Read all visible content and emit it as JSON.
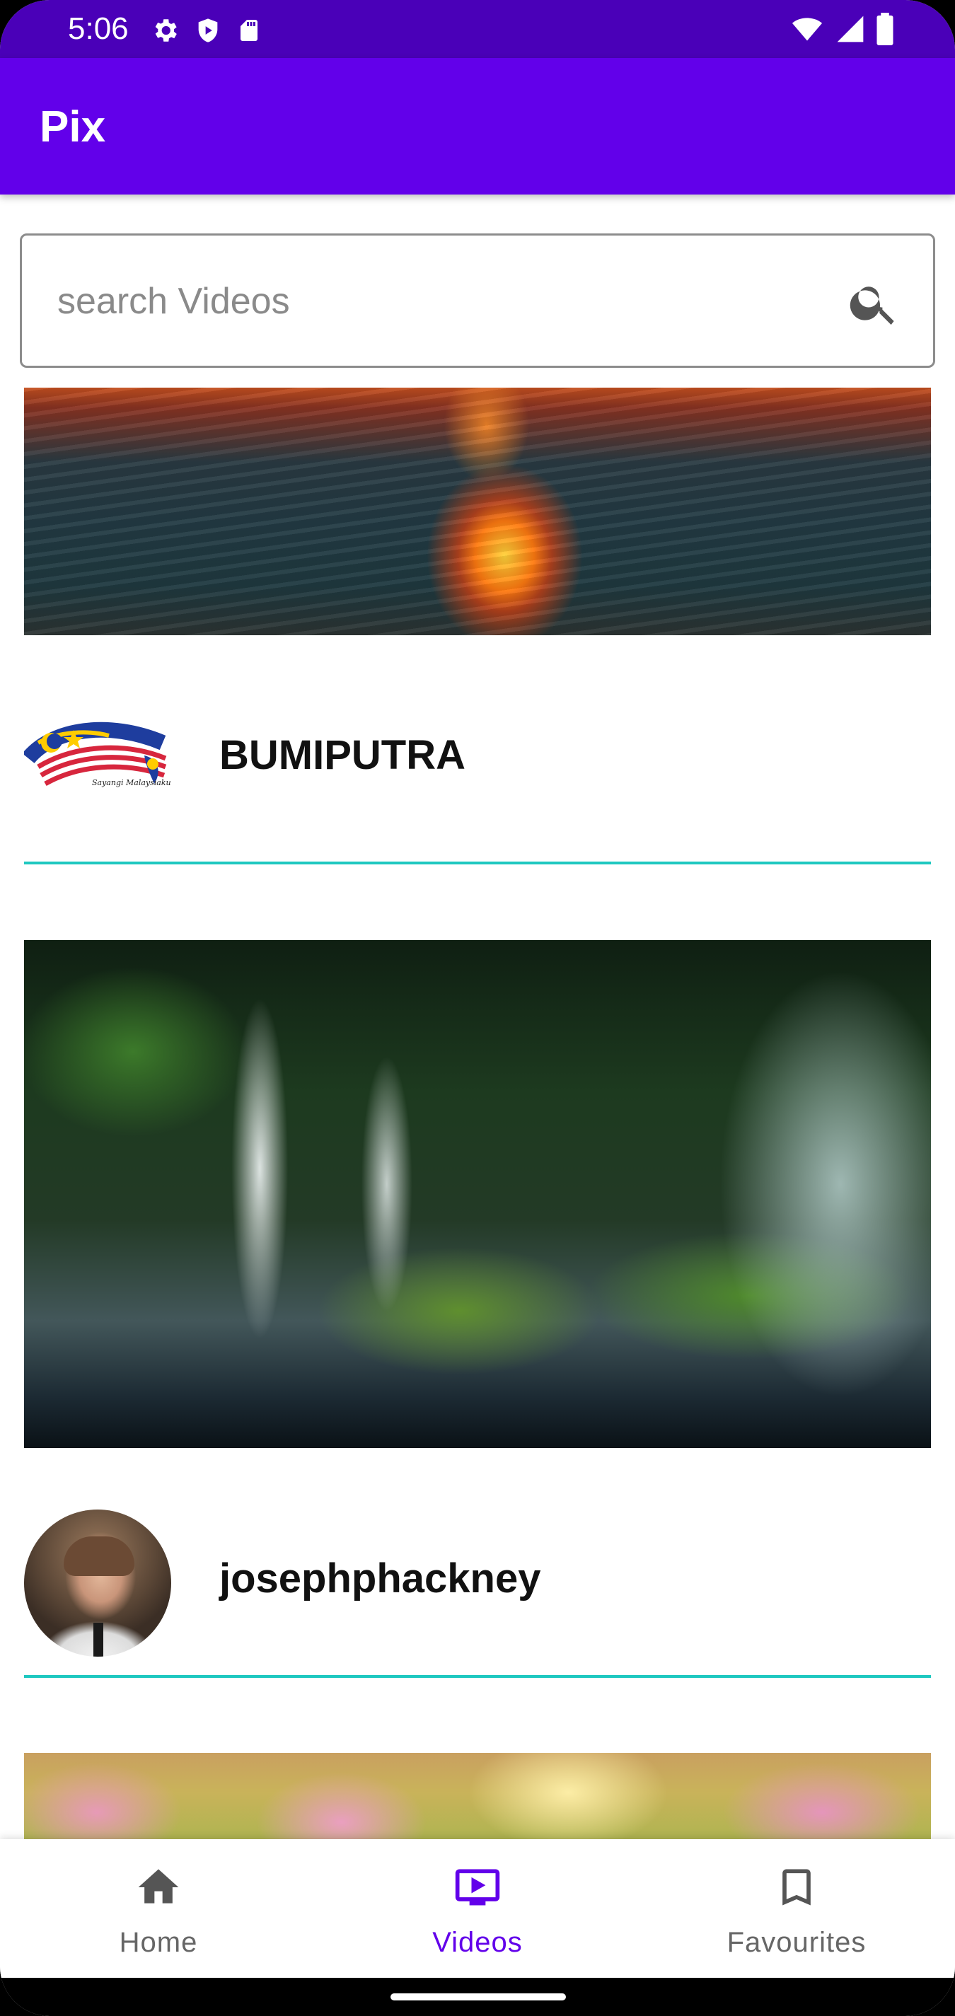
{
  "status_bar": {
    "time": "5:06",
    "left_icons": [
      "gear-icon",
      "shield-play-icon",
      "sd-card-icon"
    ],
    "right_icons": [
      "wifi-icon",
      "signal-icon",
      "battery-icon"
    ]
  },
  "app_bar": {
    "title": "Pix",
    "color": "#6200ea"
  },
  "search": {
    "placeholder": "search Videos",
    "value": "",
    "icon": "search-icon"
  },
  "feed": {
    "items": [
      {
        "thumbnail": "sunset-ocean",
        "author": ""
      },
      {
        "thumbnail": "",
        "author": "BUMIPUTRA",
        "avatar": "sayangi-malaysiaku-logo",
        "logo_text": "Sayangi Malaysiaku"
      },
      {
        "thumbnail": "forest-waterfall",
        "author": "josephphackney",
        "avatar": "person-photo"
      },
      {
        "thumbnail": "pink-flowers",
        "author": ""
      }
    ],
    "divider_color": "#1ec8c0"
  },
  "bottom_nav": {
    "items": [
      {
        "label": "Home",
        "icon": "home-icon",
        "selected": false
      },
      {
        "label": "Videos",
        "icon": "video-icon",
        "selected": true
      },
      {
        "label": "Favourites",
        "icon": "bookmark-icon",
        "selected": false
      }
    ],
    "selected_color": "#6200ea"
  }
}
